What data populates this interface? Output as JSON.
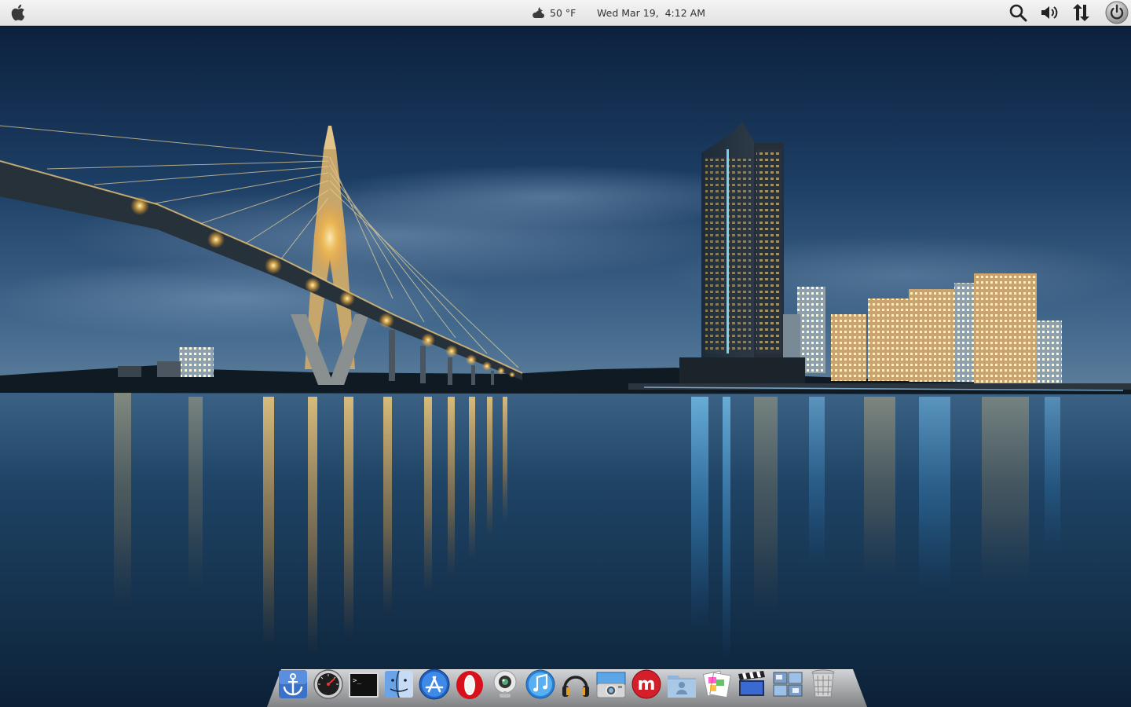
{
  "top_panel": {
    "weather": {
      "icon": "cloudy-night-icon",
      "temperature": "50 °F"
    },
    "clock": {
      "datetime": "Wed Mar 19,  4:12 AM"
    },
    "tray": [
      "search-icon",
      "volume-icon",
      "network-icon",
      "power-icon"
    ]
  },
  "dock": {
    "items": [
      {
        "name": "dock-anchor",
        "icon": "anchor-icon"
      },
      {
        "name": "dock-system-monitor",
        "icon": "gauge-icon"
      },
      {
        "name": "dock-terminal",
        "icon": "terminal-icon",
        "prompt": ">_"
      },
      {
        "name": "dock-finder",
        "icon": "finder-icon"
      },
      {
        "name": "dock-app-store",
        "icon": "app-store-icon"
      },
      {
        "name": "dock-opera",
        "icon": "opera-icon"
      },
      {
        "name": "dock-webcam",
        "icon": "webcam-icon"
      },
      {
        "name": "dock-itunes",
        "icon": "music-note-icon"
      },
      {
        "name": "dock-headphones",
        "icon": "headphones-icon"
      },
      {
        "name": "dock-image-viewer",
        "icon": "camera-icon"
      },
      {
        "name": "dock-miro",
        "icon": "miro-icon",
        "letter": "m"
      },
      {
        "name": "dock-user-folder",
        "icon": "folder-user-icon"
      },
      {
        "name": "dock-preview",
        "icon": "photos-icon"
      },
      {
        "name": "dock-video-editor",
        "icon": "clapperboard-icon"
      },
      {
        "name": "dock-workspaces",
        "icon": "workspaces-icon"
      },
      {
        "name": "dock-trash",
        "icon": "trash-icon"
      }
    ]
  },
  "colors": {
    "panel_bg": "#e8e8e8",
    "sky_top": "#0c1e3a",
    "sky_horizon": "#3a5f86",
    "water": "#163552",
    "city_lights": "#ffcf6a"
  }
}
